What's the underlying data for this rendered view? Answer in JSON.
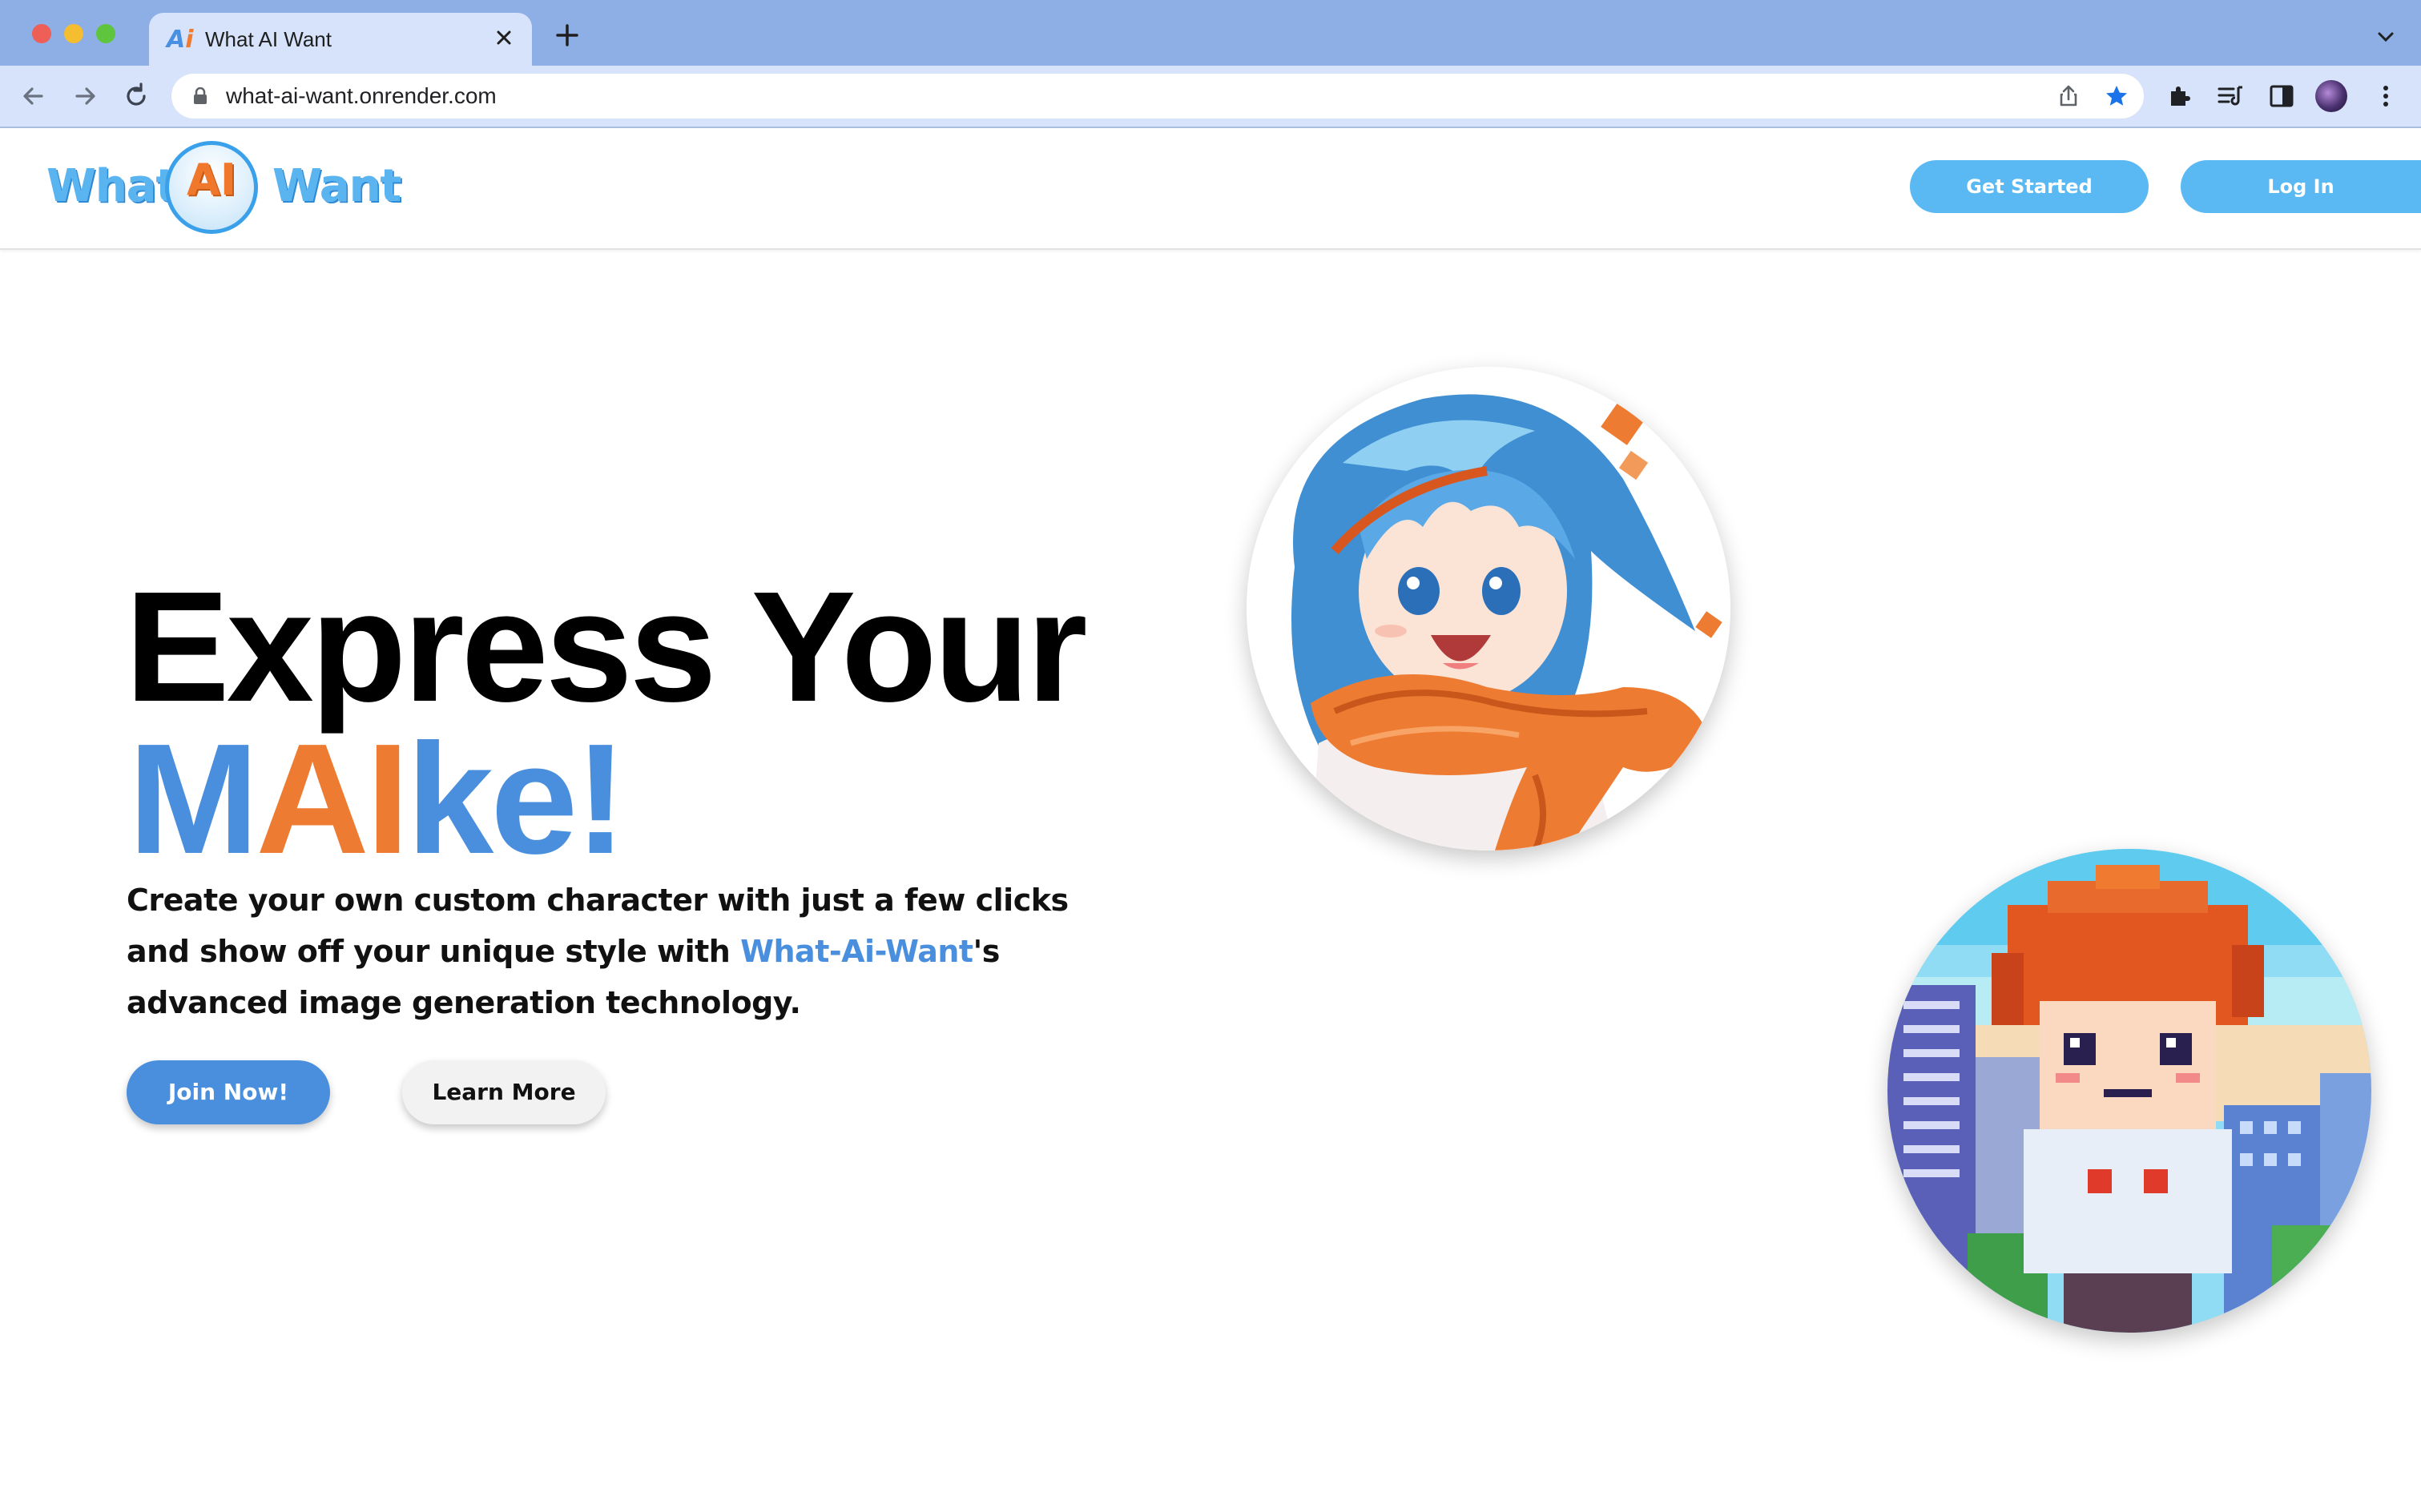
{
  "browser": {
    "tab_title": "What AI Want",
    "favicon_text": "A",
    "favicon_accent": "i",
    "url": "what-ai-want.onrender.com",
    "icons": [
      "back-icon",
      "forward-icon",
      "reload-icon",
      "lock-icon",
      "share-icon",
      "bookmark-star-icon",
      "extensions-icon",
      "reading-list-icon",
      "side-panel-icon",
      "profile-avatar-icon",
      "kebab-menu-icon",
      "tab-close-icon",
      "new-tab-icon",
      "tab-search-chevron-icon"
    ]
  },
  "header": {
    "logo": {
      "word_left": "What",
      "center": "AI",
      "word_right": "Want"
    },
    "get_started_label": "Get Started",
    "login_label": "Log In"
  },
  "hero": {
    "title_line1": "Express Your",
    "title_line2": {
      "part1": "M",
      "part2": "AI",
      "part3": "ke!"
    },
    "description": {
      "before": "Create your own custom character with just a few clicks and show off your unique style with ",
      "brand": "What-Ai-Want",
      "after": "'s advanced image generation technology."
    },
    "join_label": "Join Now!",
    "learn_label": "Learn More"
  },
  "colors": {
    "accent_blue": "#4a8fdd",
    "accent_orange": "#ee7b32",
    "header_button": "#5ab9f3",
    "chrome_tabstrip": "#8eaee6",
    "chrome_toolbar": "#d6e3fb"
  }
}
